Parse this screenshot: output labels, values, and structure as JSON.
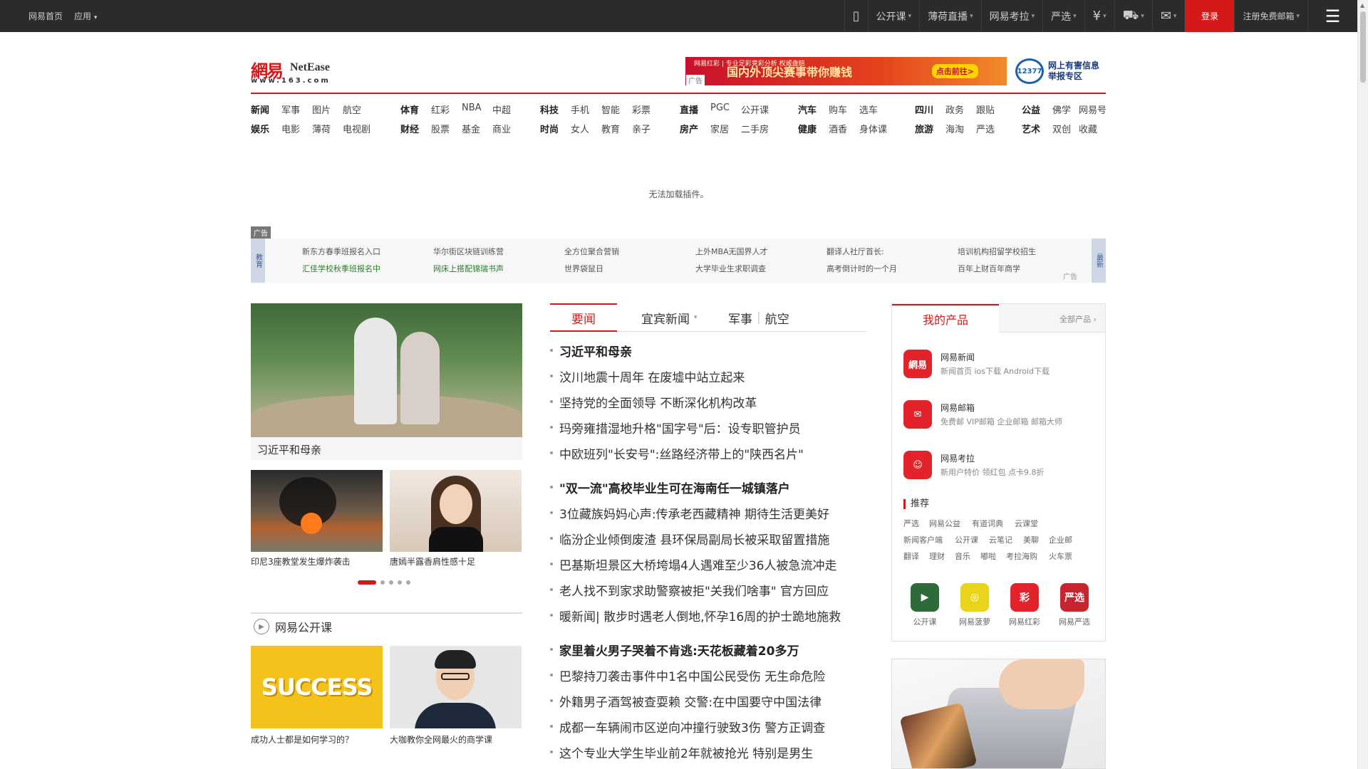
{
  "topbar": {
    "left": [
      "网易首页",
      "应用"
    ],
    "items": [
      "公开课",
      "薄荷直播",
      "网易考拉",
      "严选",
      "¥",
      "购物车",
      "邮箱"
    ],
    "login": "登录",
    "register": "注册免费邮箱"
  },
  "logo": {
    "cn": "網易",
    "en": "NetEase",
    "url": "www.163.com"
  },
  "banner": {
    "small": "网易红彩 | 专业足彩竞彩分析 权威盘赔",
    "title": "国内外顶尖赛事带你赚钱",
    "btn": "点击前往>",
    "ad": "广告"
  },
  "report": {
    "icon": "12377",
    "l1": "网上有害信息",
    "l2": "举报专区"
  },
  "nav": {
    "row1": [
      "新闻",
      "军事",
      "图片",
      "航空",
      "体育",
      "红彩",
      "NBA",
      "中超",
      "科技",
      "手机",
      "智能",
      "彩票",
      "直播",
      "PGC",
      "公开课",
      "汽车",
      "购车",
      "选车",
      "四川",
      "政务",
      "跟贴",
      "公益",
      "佛学",
      "网易号"
    ],
    "row2": [
      "娱乐",
      "电影",
      "薄荷",
      "电视剧",
      "财经",
      "股票",
      "基金",
      "商业",
      "时尚",
      "女人",
      "教育",
      "亲子",
      "房产",
      "家居",
      "二手房",
      "健康",
      "酒香",
      "身体课",
      "旅游",
      "海淘",
      "严选",
      "艺术",
      "双创",
      "收藏"
    ]
  },
  "plugin": "无法加载插件。",
  "adstrip": {
    "tag": "广告",
    "left": "教育",
    "right": "最新",
    "ad": "广告",
    "items": [
      [
        "新东方春季班报名入口",
        "汇佳学校秋季班报名中"
      ],
      [
        "华尔街区块链训练营",
        "网床上搭配锦瑞书声"
      ],
      [
        "全方位聚合营销",
        "世界袋鼠日"
      ],
      [
        "上外MBA无国界人才",
        "大学毕业生求职调查"
      ],
      [
        "翻译人社厅首长:",
        "高考倒计时的一个月"
      ],
      [
        "培训机构招留学校招生",
        "百年上财百年商学"
      ]
    ]
  },
  "left": {
    "main_caption": "习近平和母亲",
    "thumb1_caption": "印尼3座教堂发生爆炸袭击",
    "thumb2_caption": "唐嫣半露香肩性感十足",
    "oc_title": "网易公开课",
    "oc1_text": "SUCCESS",
    "oc1_caption": "成功人士都是如何学习的？",
    "oc2_caption": "大咖教你全网最火的商学课"
  },
  "tabs": {
    "t1": "要闻",
    "t2": "宜宾新闻",
    "t3a": "军事",
    "t3b": "航空"
  },
  "news": [
    {
      "t": "习近平和母亲",
      "b": true
    },
    {
      "t": "汶川地震十周年 在废墟中站立起来",
      "b": false
    },
    {
      "t": "坚持党的全面领导 不断深化机构改革",
      "b": false
    },
    {
      "t": "玛旁雍措湿地升格\"国字号\"后：设专职管护员",
      "b": false
    },
    {
      "t": "中欧班列\"长安号\":丝路经济带上的\"陕西名片\"",
      "b": false
    },
    {
      "t": "\"双一流\"高校毕业生可在海南任一城镇落户",
      "b": true
    },
    {
      "t": "3位藏族妈妈心声:传承老西藏精神 期待生活更美好",
      "b": false
    },
    {
      "t": "临汾企业倾倒废渣 县环保局副局长被采取留置措施",
      "b": false
    },
    {
      "t": "巴基斯坦景区大桥垮塌4人遇难至少36人被急流冲走",
      "b": false
    },
    {
      "t": "老人找不到家求助警察被拒\"关我们啥事\" 官方回应",
      "b": false
    },
    {
      "t": "暖新闻| 散步时遇老人倒地,怀孕16周的护士跪地施救",
      "b": false
    },
    {
      "t": "家里着火男子哭着不肯逃:天花板藏着20多万",
      "b": true
    },
    {
      "t": "巴黎持刀袭击事件中1名中国公民受伤 无生命危险",
      "b": false
    },
    {
      "t": "外籍男子酒驾被查耍赖 交警:在中国要守中国法律",
      "b": false
    },
    {
      "t": "成都一车辆闹市区逆向冲撞行驶致3伤 警方正调查",
      "b": false
    },
    {
      "t": "这个专业大学生毕业前2年就被抢光 特别是男生",
      "b": false
    }
  ],
  "products": {
    "tab": "我的产品",
    "all": "全部产品",
    "items": [
      {
        "icon": "網易",
        "name": "网易新闻",
        "links": "新闻首页  ios下载  Android下载",
        "color": "#e2232a"
      },
      {
        "icon": "✉",
        "name": "网易邮箱",
        "links": "免费邮  VIP邮箱  企业邮箱  邮箱大师",
        "color": "#e2232a"
      },
      {
        "icon": "☺",
        "name": "网易考拉",
        "links": "新用户特价  领红包  点卡9.8折",
        "color": "#e2232a"
      }
    ],
    "rec_title": "推荐",
    "rec": [
      [
        "严选",
        "网易公益",
        "有道词典",
        "云课堂"
      ],
      [
        "新闻客户端",
        "公开课",
        "云笔记",
        "美聊",
        "企业邮"
      ],
      [
        "翻译",
        "理财",
        "音乐",
        "嘟啦",
        "考拉海购",
        "火车票"
      ]
    ],
    "apps": [
      {
        "label": "公开课",
        "icon": "▶",
        "color": "#2f6b3a"
      },
      {
        "label": "网易菠萝",
        "icon": "◎",
        "color": "#e8d41a"
      },
      {
        "label": "网易红彩",
        "icon": "彩",
        "color": "#e2232a"
      },
      {
        "label": "网易严选",
        "icon": "严选",
        "color": "#c8242f"
      }
    ]
  }
}
